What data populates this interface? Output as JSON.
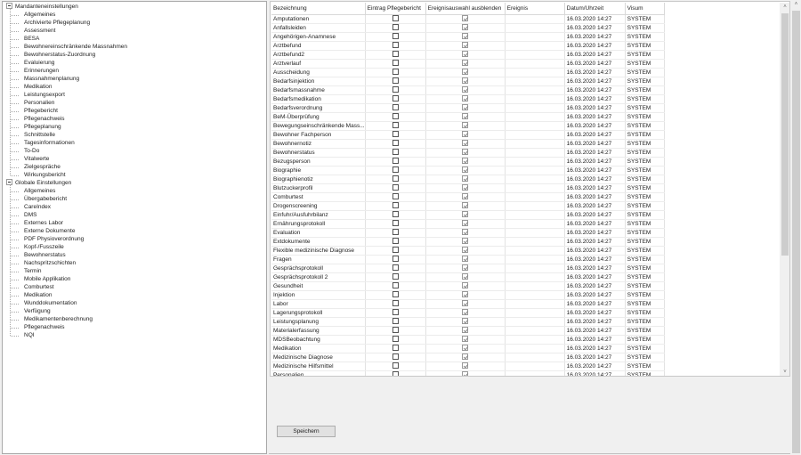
{
  "tree": {
    "groups": [
      {
        "label": "Mandanteneinstellungen",
        "children": [
          "Allgemeines",
          "Archivierte Pflegeplanung",
          "Assessment",
          "BESA",
          "Bewohnereinschränkende Massnahmen",
          "Bewohnerstatus-Zuordnung",
          "Evaluierung",
          "Erinnerungen",
          "Massnahmenplanung",
          "Medikation",
          "Leistungsexport",
          "Personalien",
          "Pflegebericht",
          "Pflegenachweis",
          "Pflegeplanung",
          "Schnittstelle",
          "Tagesinformationen",
          "To-Do",
          "Vitalwerte",
          "Zielgespräche",
          "Wirkungsbericht"
        ]
      },
      {
        "label": "Globale Einstellungen",
        "children": [
          "Allgemeines",
          "Übergabebericht",
          "CareIndex",
          "DMS",
          "Externes Labor",
          "Externe Dokumente",
          "PDF Physioverordnung",
          "Kopf-/Fusszeile",
          "Bewohnerstatus",
          "Nachspritzschichten",
          "Termin",
          "Mobile Applikation",
          "Comburtest",
          "Medikation",
          "Wunddokumentation",
          "Verfügung",
          "Medikamentenberechnung",
          "Pflegenachweis",
          "NQI"
        ]
      }
    ]
  },
  "grid": {
    "columns": [
      "Bezeichnung",
      "Eintrag Pflegebericht",
      "Ereignisauswahl ausblenden",
      "Ereignis",
      "Datum/Uhrzeit",
      "Visum"
    ],
    "default_datum": "16.03.2020 14:27",
    "default_visum": "SYSTEM",
    "rows": [
      "Amputationen",
      "Anfallsleiden",
      "Angehörigen-Anamnese",
      "Arztbefund",
      "Arztbefund2",
      "Arztverlauf",
      "Ausscheidung",
      "Bedarfsinjektion",
      "Bedarfsmassnahme",
      "Bedarfsmedikation",
      "Bedarfsverordnung",
      "BeM-Überprüfung",
      "Bewegungseinschränkende Mass...",
      "Bewohner Fachperson",
      "Bewohnernotiz",
      "Bewohnerstatus",
      "Bezugsperson",
      "Biographie",
      "Biographienotiz",
      "Blutzuckerprofil",
      "Comburtest",
      "Drogenscreening",
      "Einfuhr/Ausfuhrbilanz",
      "Ernährungsprotokoll",
      "Evaluation",
      "Extdokumente",
      "Flexible medizinische Diagnose",
      "Fragen",
      "Gesprächsprotokoll",
      "Gesprächsprotokoll 2",
      "Gesundheit",
      "Injektion",
      "Labor",
      "Lagerungsprotokoll",
      "Leistungsplanung",
      "Materialerfassung",
      "MDSBeobachtung",
      "Medikation",
      "Medizinische Diagnose",
      "Medizinische Hilfsmittel",
      "Personalien"
    ],
    "eintrag_pflegebericht_checked": false,
    "ereignisauswahl_ausblenden_checked": true,
    "ereignis": ""
  },
  "save_label": "Speichern",
  "icons": {
    "scroll_up": "▲",
    "scroll_down": "▼"
  }
}
